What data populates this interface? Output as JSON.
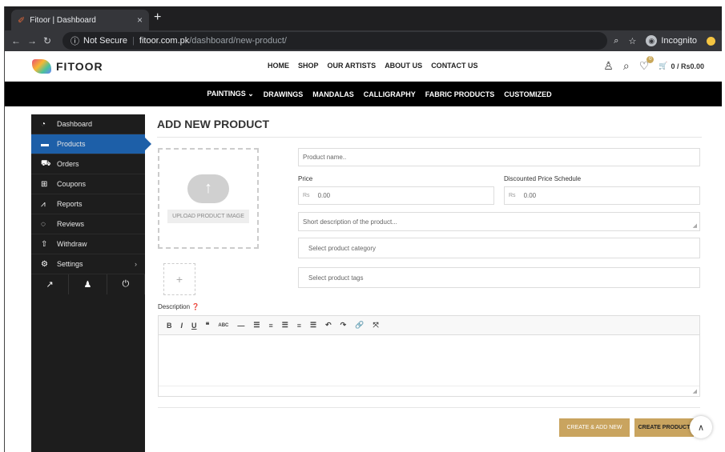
{
  "browser": {
    "tab_title": "Fitoor | Dashboard",
    "tab_close": "×",
    "new_tab": "+",
    "not_secure": "Not Secure",
    "url_host": "fitoor.com.pk",
    "url_path": "/dashboard/new-product/",
    "incognito": "Incognito"
  },
  "site": {
    "logo": "FITOOR",
    "nav": [
      "HOME",
      "SHOP",
      "OUR ARTISTS",
      "ABOUT US",
      "CONTACT US"
    ],
    "cart": "0 / Rs0.00",
    "wishlist_count": "0",
    "categories": [
      "PAINTINGS ⌄",
      "DRAWINGS",
      "MANDALAS",
      "CALLIGRAPHY",
      "FABRIC PRODUCTS",
      "CUSTOMIZED"
    ]
  },
  "sidebar": {
    "items": [
      {
        "label": "Dashboard",
        "icon": "dashboard-icon"
      },
      {
        "label": "Products",
        "icon": "briefcase-icon"
      },
      {
        "label": "Orders",
        "icon": "cart-icon"
      },
      {
        "label": "Coupons",
        "icon": "gift-icon"
      },
      {
        "label": "Reports",
        "icon": "chart-icon"
      },
      {
        "label": "Reviews",
        "icon": "comments-icon"
      },
      {
        "label": "Withdraw",
        "icon": "upload-icon"
      },
      {
        "label": "Settings",
        "icon": "gear-icon"
      }
    ],
    "active": "Products",
    "accent": "#1d5fa8"
  },
  "form": {
    "title": "ADD NEW PRODUCT",
    "upload_label": "UPLOAD PRODUCT IMAGE",
    "product_name_placeholder": "Product name..",
    "price_label": "Price",
    "price_currency": "Rs",
    "price_placeholder": "0.00",
    "discount_label": "Discounted Price Schedule",
    "discount_currency": "Rs",
    "discount_placeholder": "0.00",
    "short_desc_placeholder": "Short description of the product...",
    "category_placeholder": "Select product category",
    "tags_placeholder": "Select product tags",
    "description_label": "Description",
    "btn_create_add_new": "CREATE & ADD NEW",
    "btn_create": "CREATE PRODUCT",
    "button_color": "#c9a45f"
  }
}
